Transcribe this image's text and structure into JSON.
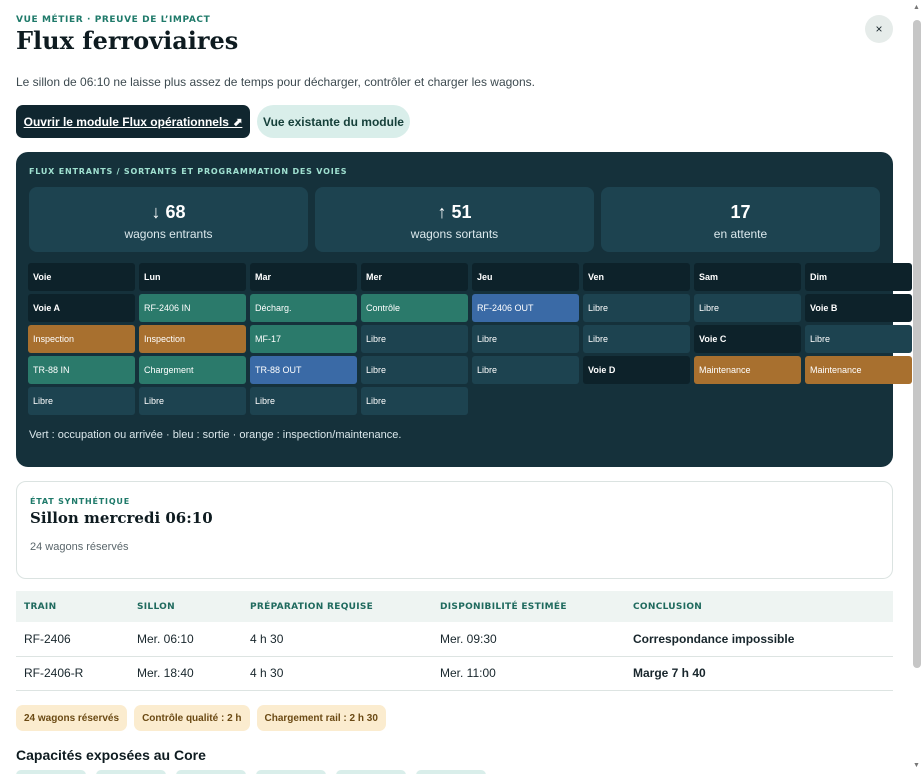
{
  "header": {
    "eyebrow": "VUE MÉTIER · PREUVE DE L’IMPACT",
    "title": "Flux ferroviaires",
    "close_icon": "×",
    "subtitle": "Le sillon de 06:10 ne laisse plus assez de temps pour décharger, contrôler et charger les wagons."
  },
  "actions": {
    "open_module": "Ouvrir le module Flux opérationnels ⬈",
    "existing_view": "Vue existante du module"
  },
  "flux": {
    "heading": "FLUX ENTRANTS / SORTANTS ET PROGRAMMATION DES VOIES",
    "stats": [
      {
        "value": "↓ 68",
        "label": "wagons entrants"
      },
      {
        "value": "↑ 51",
        "label": "wagons sortants"
      },
      {
        "value": "17",
        "label": "en attente"
      }
    ],
    "columns": [
      "Voie",
      "Lun",
      "Mar",
      "Mer",
      "Jeu",
      "Ven",
      "Sam",
      "Dim"
    ],
    "cells": [
      {
        "text": "Voie A",
        "kind": "label"
      },
      {
        "text": "RF-2406 IN",
        "kind": "occup"
      },
      {
        "text": "Décharg.",
        "kind": "occup"
      },
      {
        "text": "Contrôle",
        "kind": "occup"
      },
      {
        "text": "RF-2406 OUT",
        "kind": "sortie"
      },
      {
        "text": "Libre",
        "kind": "libre"
      },
      {
        "text": "Libre",
        "kind": "libre"
      },
      {
        "text": "Voie B",
        "kind": "label"
      },
      {
        "text": "Inspection",
        "kind": "maint"
      },
      {
        "text": "Inspection",
        "kind": "maint"
      },
      {
        "text": "MF-17",
        "kind": "occup"
      },
      {
        "text": "Libre",
        "kind": "libre"
      },
      {
        "text": "Libre",
        "kind": "libre"
      },
      {
        "text": "Libre",
        "kind": "libre"
      },
      {
        "text": "Voie C",
        "kind": "label"
      },
      {
        "text": "Libre",
        "kind": "libre"
      },
      {
        "text": "TR-88 IN",
        "kind": "occup"
      },
      {
        "text": "Chargement",
        "kind": "occup"
      },
      {
        "text": "TR-88 OUT",
        "kind": "sortie"
      },
      {
        "text": "Libre",
        "kind": "libre"
      },
      {
        "text": "Libre",
        "kind": "libre"
      },
      {
        "text": "Voie D",
        "kind": "label"
      },
      {
        "text": "Maintenance",
        "kind": "maint"
      },
      {
        "text": "Maintenance",
        "kind": "maint"
      },
      {
        "text": "Libre",
        "kind": "libre"
      },
      {
        "text": "Libre",
        "kind": "libre"
      },
      {
        "text": "Libre",
        "kind": "libre"
      },
      {
        "text": "Libre",
        "kind": "libre"
      }
    ],
    "legend": "Vert : occupation ou arrivée · bleu : sortie · orange : inspection/maintenance."
  },
  "synthese": {
    "eyebrow": "ÉTAT SYNTHÉTIQUE",
    "title": "Sillon mercredi 06:10",
    "subtitle": "24 wagons réservés"
  },
  "table": {
    "headers": [
      "TRAIN",
      "SILLON",
      "PRÉPARATION REQUISE",
      "DISPONIBILITÉ ESTIMÉE",
      "CONCLUSION"
    ],
    "rows": [
      [
        "RF-2406",
        "Mer. 06:10",
        "4 h 30",
        "Mer. 09:30",
        "Correspondance impossible"
      ],
      [
        "RF-2406-R",
        "Mer. 18:40",
        "4 h 30",
        "Mer. 11:00",
        "Marge 7 h 40"
      ]
    ]
  },
  "chips": [
    "24 wagons réservés",
    "Contrôle qualité : 2 h",
    "Chargement rail : 2 h 30"
  ],
  "capacites": {
    "title": "Capacités exposées au Core"
  },
  "icons": {
    "close": "close-icon"
  }
}
